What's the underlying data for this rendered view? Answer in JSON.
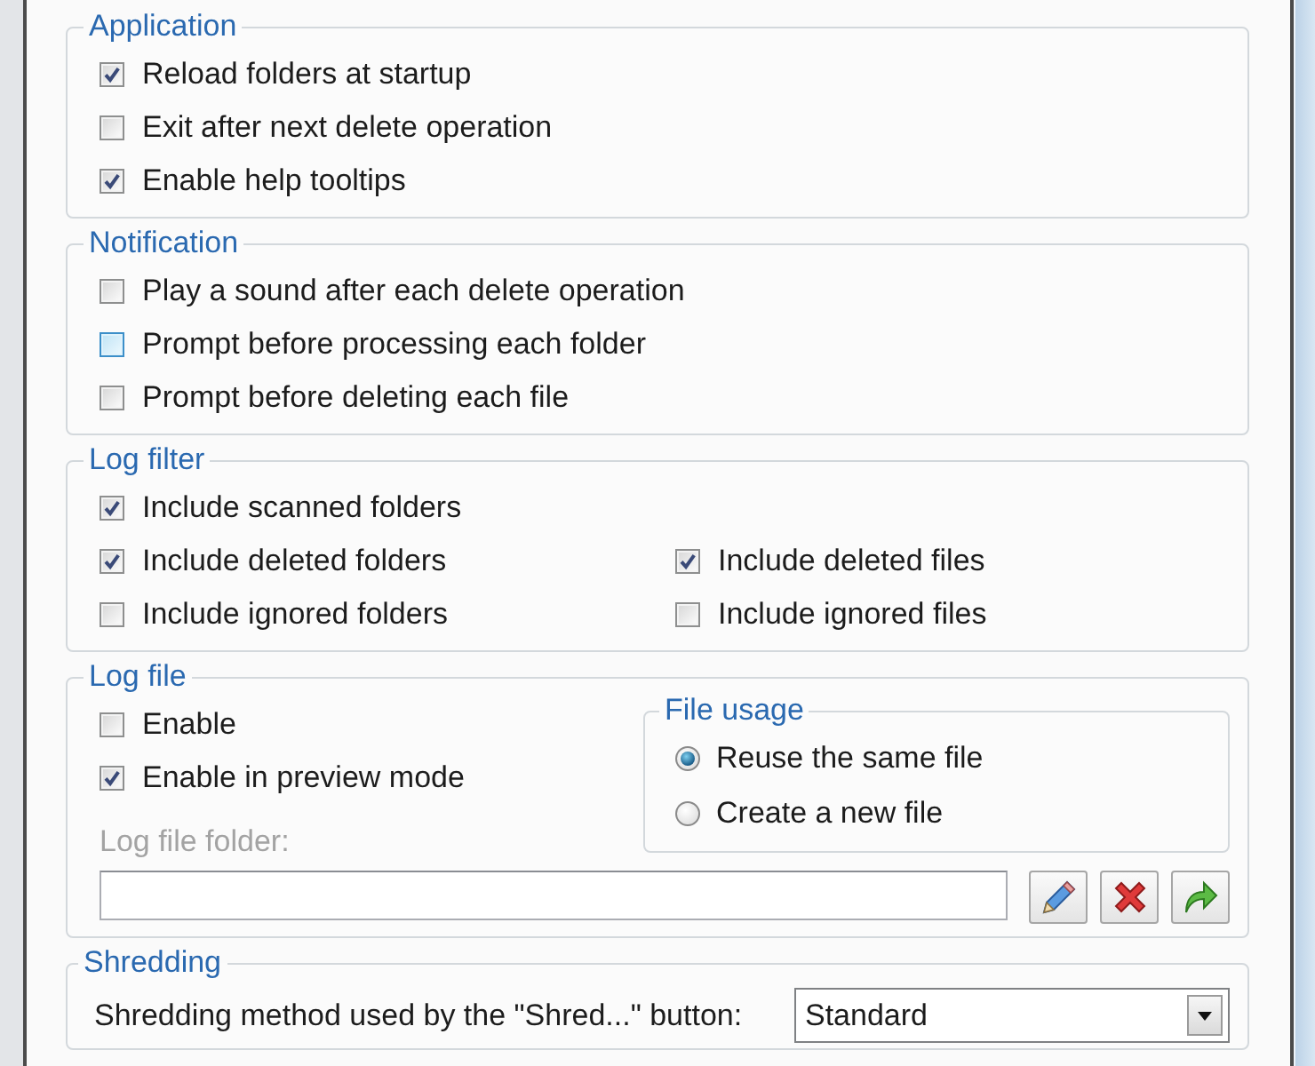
{
  "application": {
    "title": "Application",
    "options": [
      {
        "label": "Reload folders at startup",
        "checked": true
      },
      {
        "label": "Exit after next delete operation",
        "checked": false
      },
      {
        "label": "Enable help tooltips",
        "checked": true
      }
    ]
  },
  "notification": {
    "title": "Notification",
    "options": [
      {
        "label": "Play a sound after each delete operation",
        "checked": false,
        "hovered": false
      },
      {
        "label": "Prompt before processing each folder",
        "checked": false,
        "hovered": true
      },
      {
        "label": "Prompt before deleting each file",
        "checked": false,
        "hovered": false
      }
    ]
  },
  "log_filter": {
    "title": "Log filter",
    "rows": [
      [
        {
          "label": "Include scanned folders",
          "checked": true
        }
      ],
      [
        {
          "label": "Include deleted folders",
          "checked": true
        },
        {
          "label": "Include deleted files",
          "checked": true
        }
      ],
      [
        {
          "label": "Include ignored folders",
          "checked": false
        },
        {
          "label": "Include ignored files",
          "checked": false
        }
      ]
    ]
  },
  "log_file": {
    "title": "Log file",
    "options": [
      {
        "label": "Enable",
        "checked": false
      },
      {
        "label": "Enable in preview mode",
        "checked": true
      }
    ],
    "file_usage": {
      "title": "File usage",
      "choices": [
        {
          "label": "Reuse the same file",
          "selected": true
        },
        {
          "label": "Create a new file",
          "selected": false
        }
      ]
    },
    "folder_label": {
      "text": "Log file folder:",
      "disabled": true
    },
    "tool_buttons": [
      {
        "kind": "edit"
      },
      {
        "kind": "delete"
      },
      {
        "kind": "go"
      }
    ]
  },
  "shredding": {
    "title": "Shredding",
    "label": "Shredding method used by the \"Shred...\" button:",
    "method": "Standard"
  }
}
